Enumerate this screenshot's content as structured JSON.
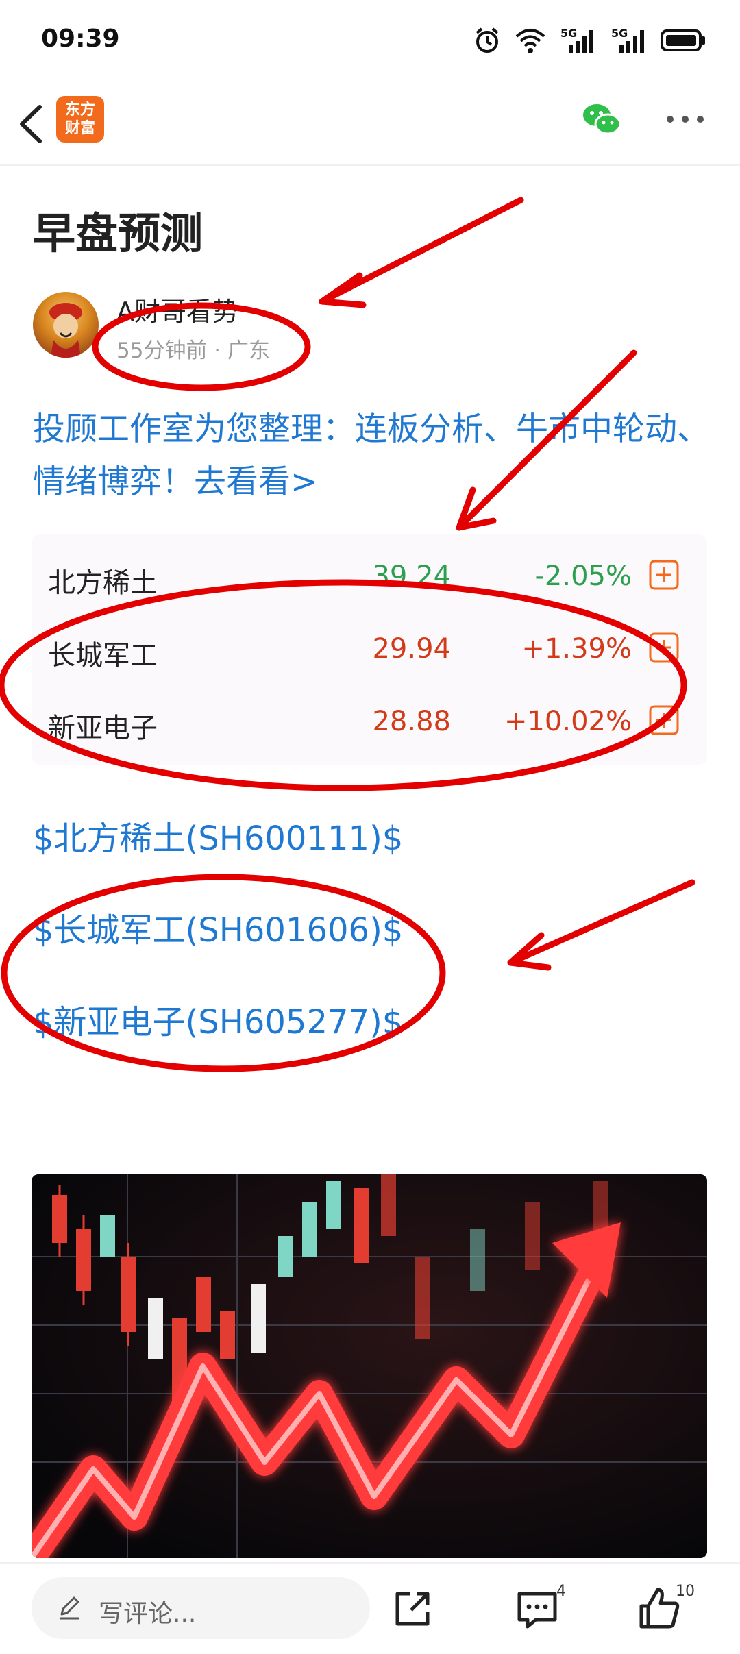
{
  "status_bar": {
    "time": "09:39",
    "net1": "5G",
    "net2": "5G"
  },
  "nav": {
    "logo_line1": "东方",
    "logo_line2": "财富"
  },
  "article": {
    "title": "早盘预测",
    "author": "A财哥看势",
    "meta": "55分钟前 · 广东",
    "promo": "投顾工作室为您整理：连板分析、牛市中轮动、情绪博弈！去看看>"
  },
  "stocks": [
    {
      "name": "北方稀土",
      "price": "39.24",
      "change": "-2.05%",
      "color": "#2e9e4f"
    },
    {
      "name": "长城军工",
      "price": "29.94",
      "change": "+1.39%",
      "color": "#d23b1a"
    },
    {
      "name": "新亚电子",
      "price": "28.88",
      "change": "+10.02%",
      "color": "#d23b1a"
    }
  ],
  "tags": [
    "$北方稀土(SH600111)$",
    "$长城军工(SH601606)$",
    "$新亚电子(SH605277)$"
  ],
  "bottom": {
    "comment_placeholder": "写评论...",
    "comment_count": "4",
    "like_count": "10"
  },
  "colors": {
    "link": "#1f78d1",
    "accent": "#f26b1d",
    "annotation": "#e30000"
  }
}
